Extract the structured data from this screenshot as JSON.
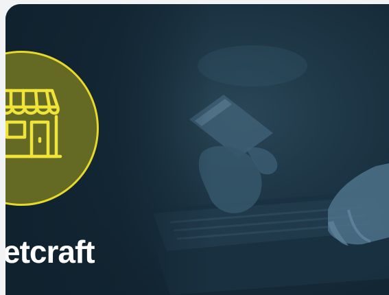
{
  "brand": {
    "name": "etcraft"
  },
  "badge": {
    "icon": "storefront-icon",
    "fill_color": "#646a24",
    "ring_color": "#e6d92a"
  },
  "photo": {
    "subject": "hands-with-card-and-laptop"
  }
}
